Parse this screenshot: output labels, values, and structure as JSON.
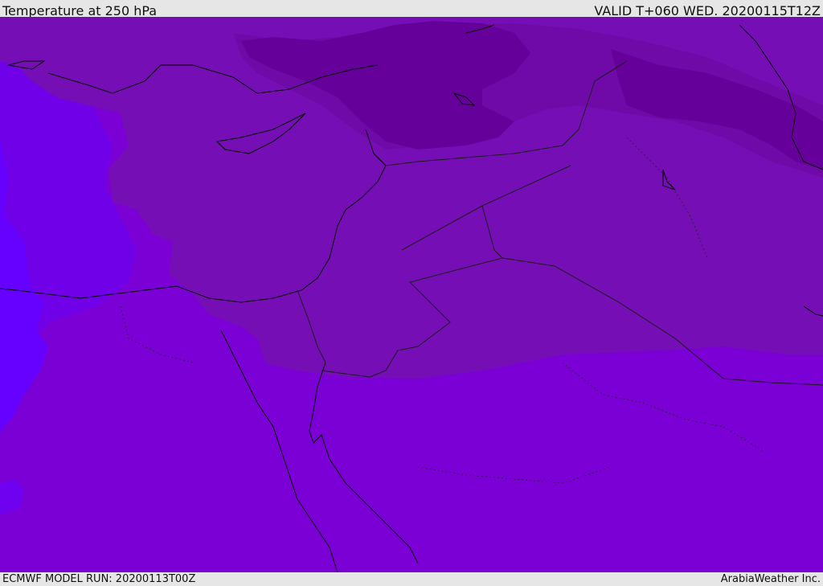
{
  "header": {
    "title": "Temperature at 250 hPa",
    "valid": "VALID T+060 WED. 20200115T12Z"
  },
  "footer": {
    "model_run": "ECMWF MODEL RUN: 20200113T00Z",
    "credit": "ArabiaWeather Inc."
  },
  "map": {
    "colors": {
      "coldest": "#66009a",
      "cold": "#6f0aa8",
      "cool": "#750fb5",
      "base": "#7b00d6",
      "warm": "#7000e8",
      "warmest": "#6600ff",
      "coastline": "#000000",
      "border": "#1a1a1a"
    }
  }
}
